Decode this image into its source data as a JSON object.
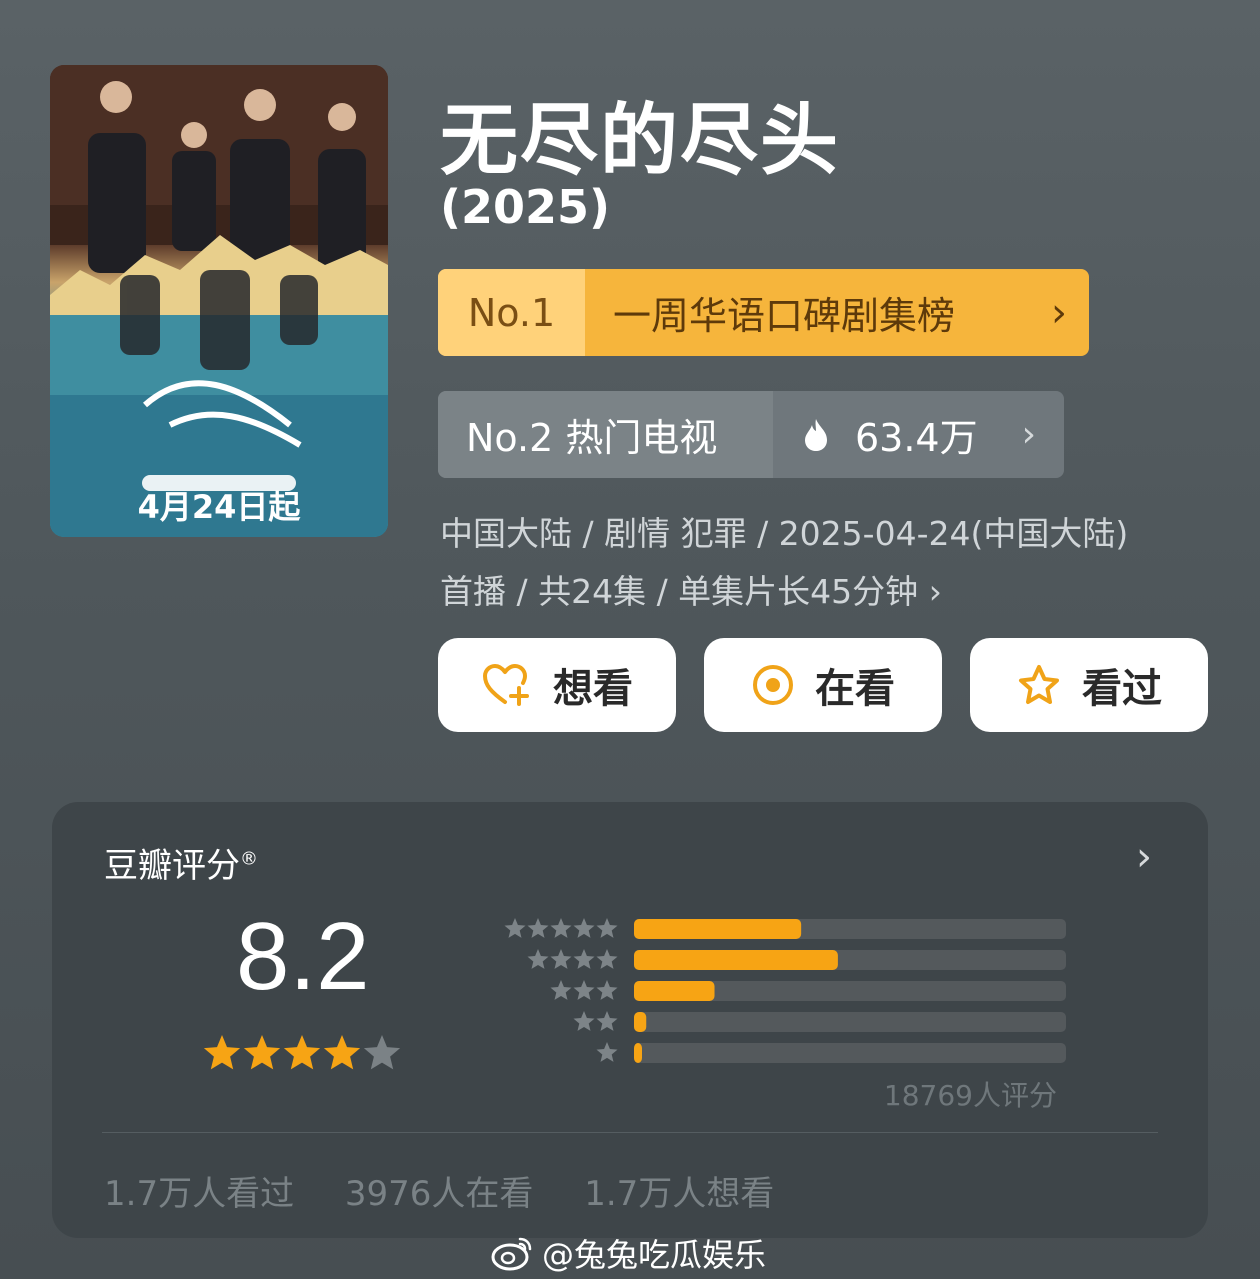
{
  "poster": {
    "date_text": "4月24日起"
  },
  "header": {
    "title": "无尽的尽头",
    "year": "(2025)"
  },
  "rank_primary": {
    "number": "No.1",
    "label": "一周华语口碑剧集榜",
    "chevron": "›"
  },
  "rank_secondary": {
    "label": "No.2 热门电视",
    "heat": "63.4万",
    "chevron": "›",
    "icon": "flame-icon"
  },
  "meta": {
    "line1": "中国大陆 / 剧情 犯罪 / 2025-04-24(中国大陆)",
    "line2": "首播 / 共24集 / 单集片长45分钟",
    "chevron": "›"
  },
  "actions": {
    "want_label": "想看",
    "watching_label": "在看",
    "watched_label": "看过"
  },
  "rating": {
    "title": "豆瓣评分",
    "registered_mark": "®",
    "chevron": "›",
    "score": "8.2",
    "stars_filled": 4,
    "stars_total": 5,
    "distribution_pct": [
      35.5,
      43.3,
      17.1,
      2.6,
      1.2
    ],
    "total_raters": "18769人评分",
    "accent_color": "#f7a414",
    "bar_track_color": "#54595c"
  },
  "stats": {
    "watched": "1.7万人看过",
    "watching": "3976人在看",
    "want": "1.7万人想看"
  },
  "watermark": {
    "text": "@兔兔吃瓜娱乐",
    "icon": "weibo-icon"
  }
}
